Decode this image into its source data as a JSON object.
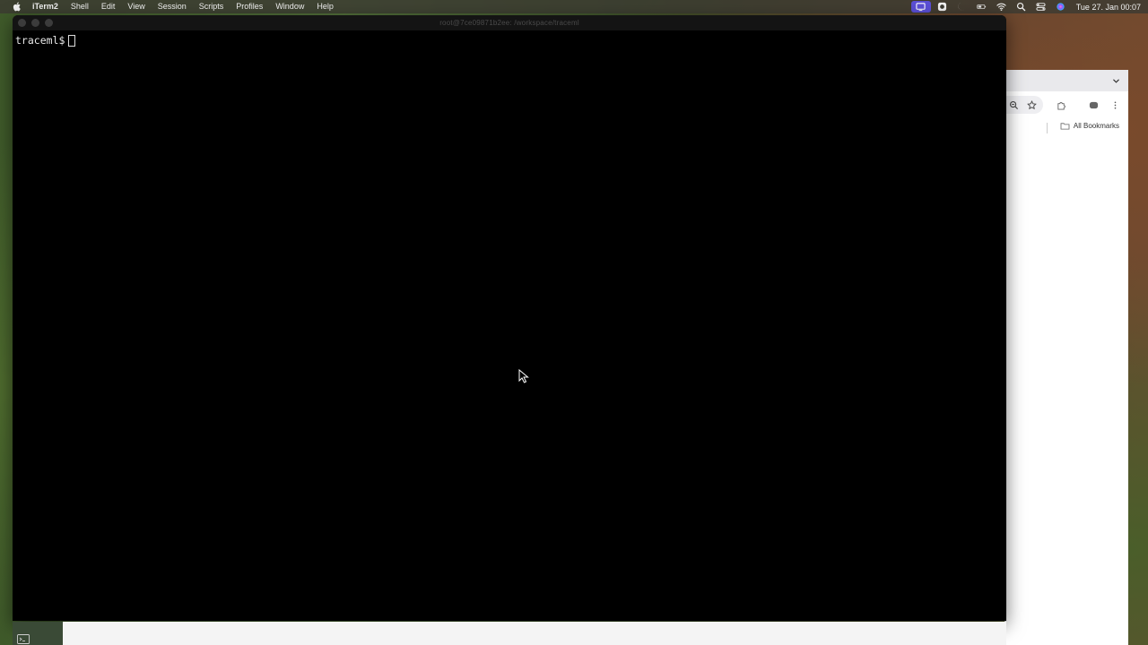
{
  "menubar": {
    "app_name": "iTerm2",
    "items": [
      "Shell",
      "Edit",
      "View",
      "Session",
      "Scripts",
      "Profiles",
      "Window",
      "Help"
    ],
    "clock": "Tue 27. Jan  00:07",
    "status_icons": [
      "screen-share-icon",
      "record-icon",
      "moon-icon",
      "battery-icon",
      "wifi-icon",
      "spotlight-icon",
      "control-center-icon",
      "siri-icon"
    ]
  },
  "terminal": {
    "window_title": "root@7ce09871b2ee: /workspace/traceml",
    "prompt": "traceml$",
    "background": "#000000",
    "text_color": "#e8e8e8"
  },
  "browser": {
    "bookmarks_label": "All Bookmarks",
    "toolbar_icons": [
      "zoom-icon",
      "star-icon",
      "extensions-icon",
      "profile-icon",
      "more-icon"
    ]
  },
  "colors": {
    "menubar_bg": "#3c3a32",
    "highlight": "#5b4fd6"
  }
}
